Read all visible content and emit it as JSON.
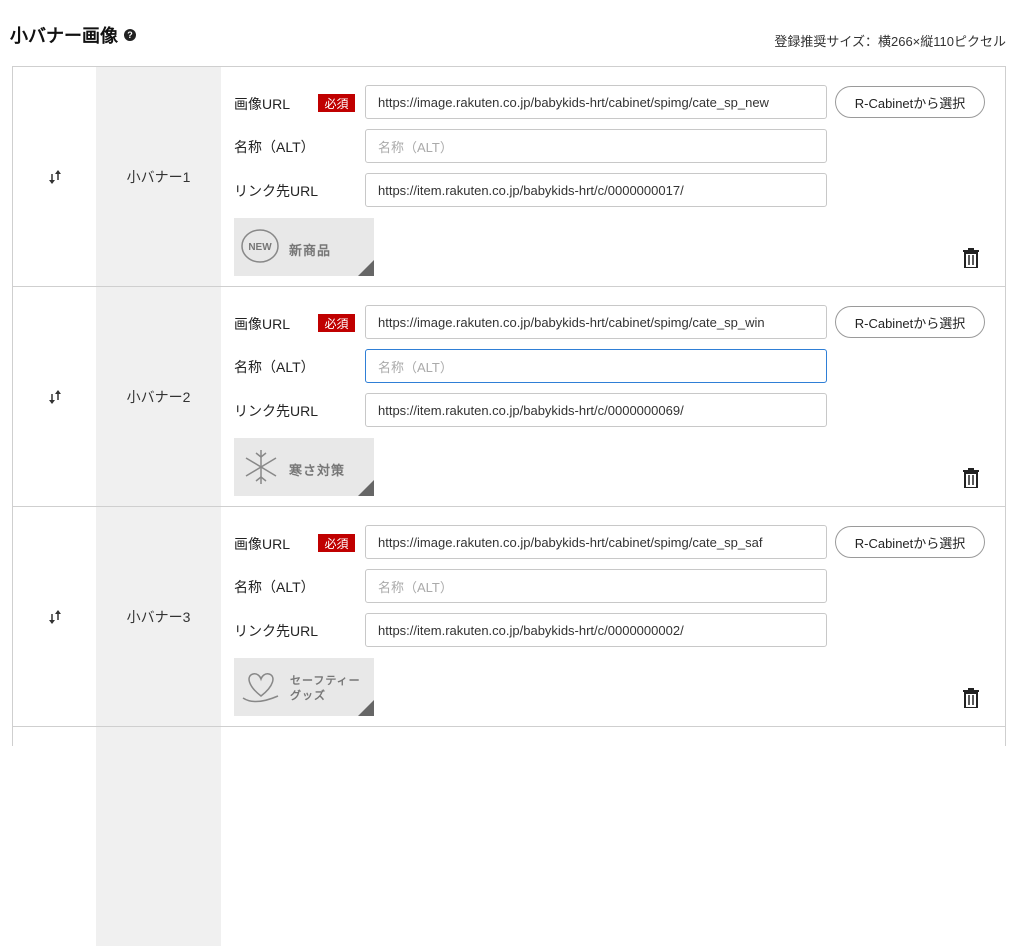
{
  "header": {
    "title": "小バナー画像",
    "size_note": "登録推奨サイズ：横266×縦110ピクセル"
  },
  "labels": {
    "image_url": "画像URL",
    "required": "必須",
    "alt": "名称（ALT）",
    "link_url": "リンク先URL",
    "rcabinet_button": "R-Cabinetから選択",
    "alt_placeholder": "名称（ALT）"
  },
  "rows": [
    {
      "name": "小バナー1",
      "image_url": "https://image.rakuten.co.jp/babykids-hrt/cabinet/spimg/cate_sp_new",
      "alt": "",
      "link_url": "https://item.rakuten.co.jp/babykids-hrt/c/0000000017/",
      "thumb": {
        "badge": "NEW",
        "text": "新商品",
        "icon": "new-badge-icon"
      }
    },
    {
      "name": "小バナー2",
      "image_url": "https://image.rakuten.co.jp/babykids-hrt/cabinet/spimg/cate_sp_win",
      "alt": "",
      "link_url": "https://item.rakuten.co.jp/babykids-hrt/c/0000000069/",
      "thumb": {
        "text": "寒さ対策",
        "icon": "snowflake-icon"
      }
    },
    {
      "name": "小バナー3",
      "image_url": "https://image.rakuten.co.jp/babykids-hrt/cabinet/spimg/cate_sp_saf",
      "alt": "",
      "link_url": "https://item.rakuten.co.jp/babykids-hrt/c/0000000002/",
      "thumb": {
        "text_line1": "セーフティー",
        "text_line2": "グッズ",
        "icon": "heart-hand-icon"
      }
    }
  ]
}
